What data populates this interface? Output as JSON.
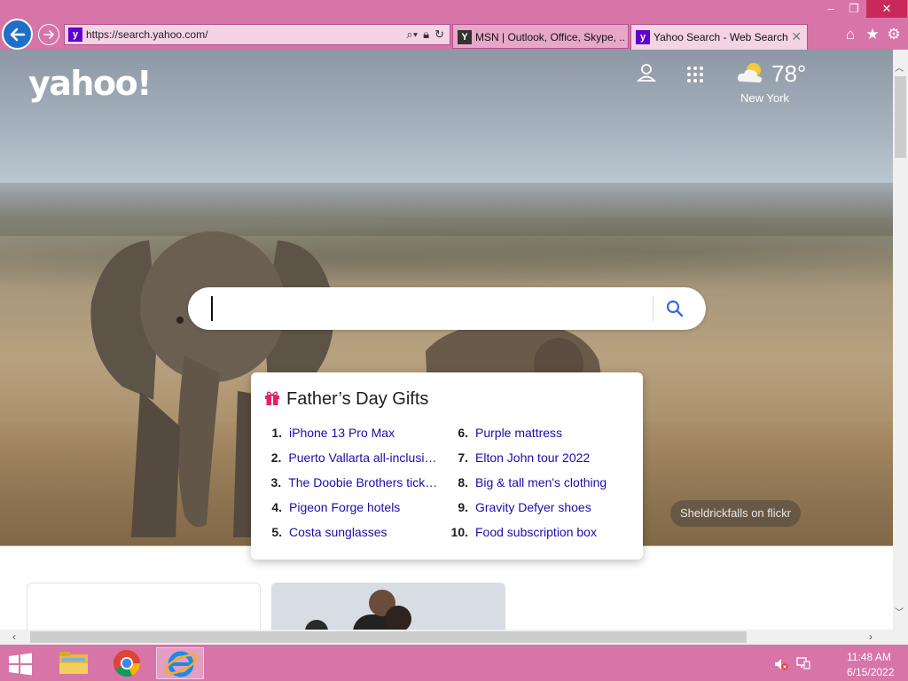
{
  "window": {
    "minimize": "–",
    "maximize": "❐",
    "close": "✕"
  },
  "address": {
    "url": "https://search.yahoo.com/"
  },
  "tabs": [
    {
      "label": "MSN | Outlook, Office, Skype, ...",
      "favicon": "msn-favicon",
      "active": false
    },
    {
      "label": "Yahoo Search - Web Search",
      "favicon": "yahoo-favicon",
      "active": true,
      "close": "✕"
    }
  ],
  "toolbar": {
    "home": "⌂",
    "favorites": "★",
    "settings": "⚙"
  },
  "page": {
    "logo": "yahoo!",
    "weather": {
      "temp": "78°",
      "city": "New York",
      "icon": "partly-cloudy-icon"
    },
    "search": {
      "value": "",
      "placeholder": ""
    },
    "photo_credit": "Sheldrickfalls on flickr",
    "trending": {
      "title": "Father’s Day Gifts",
      "items": [
        {
          "num": "1.",
          "text": "iPhone 13 Pro Max"
        },
        {
          "num": "2.",
          "text": "Puerto Vallarta all-inclusiv…"
        },
        {
          "num": "3.",
          "text": "The Doobie Brothers ticke…"
        },
        {
          "num": "4.",
          "text": "Pigeon Forge hotels"
        },
        {
          "num": "5.",
          "text": "Costa sunglasses"
        },
        {
          "num": "6.",
          "text": "Purple mattress"
        },
        {
          "num": "7.",
          "text": "Elton John tour 2022"
        },
        {
          "num": "8.",
          "text": "Big & tall men's clothing"
        },
        {
          "num": "9.",
          "text": "Gravity Defyer shoes"
        },
        {
          "num": "10.",
          "text": "Food subscription box"
        }
      ]
    }
  },
  "taskbar": {
    "apps": [
      "file-explorer",
      "chrome",
      "internet-explorer"
    ],
    "clock": {
      "time": "11:48 AM",
      "date": "6/15/2022"
    }
  },
  "colors": {
    "chrome": "#d774a8",
    "link": "#1a0dab",
    "yahoo_purple": "#5f01d1"
  }
}
